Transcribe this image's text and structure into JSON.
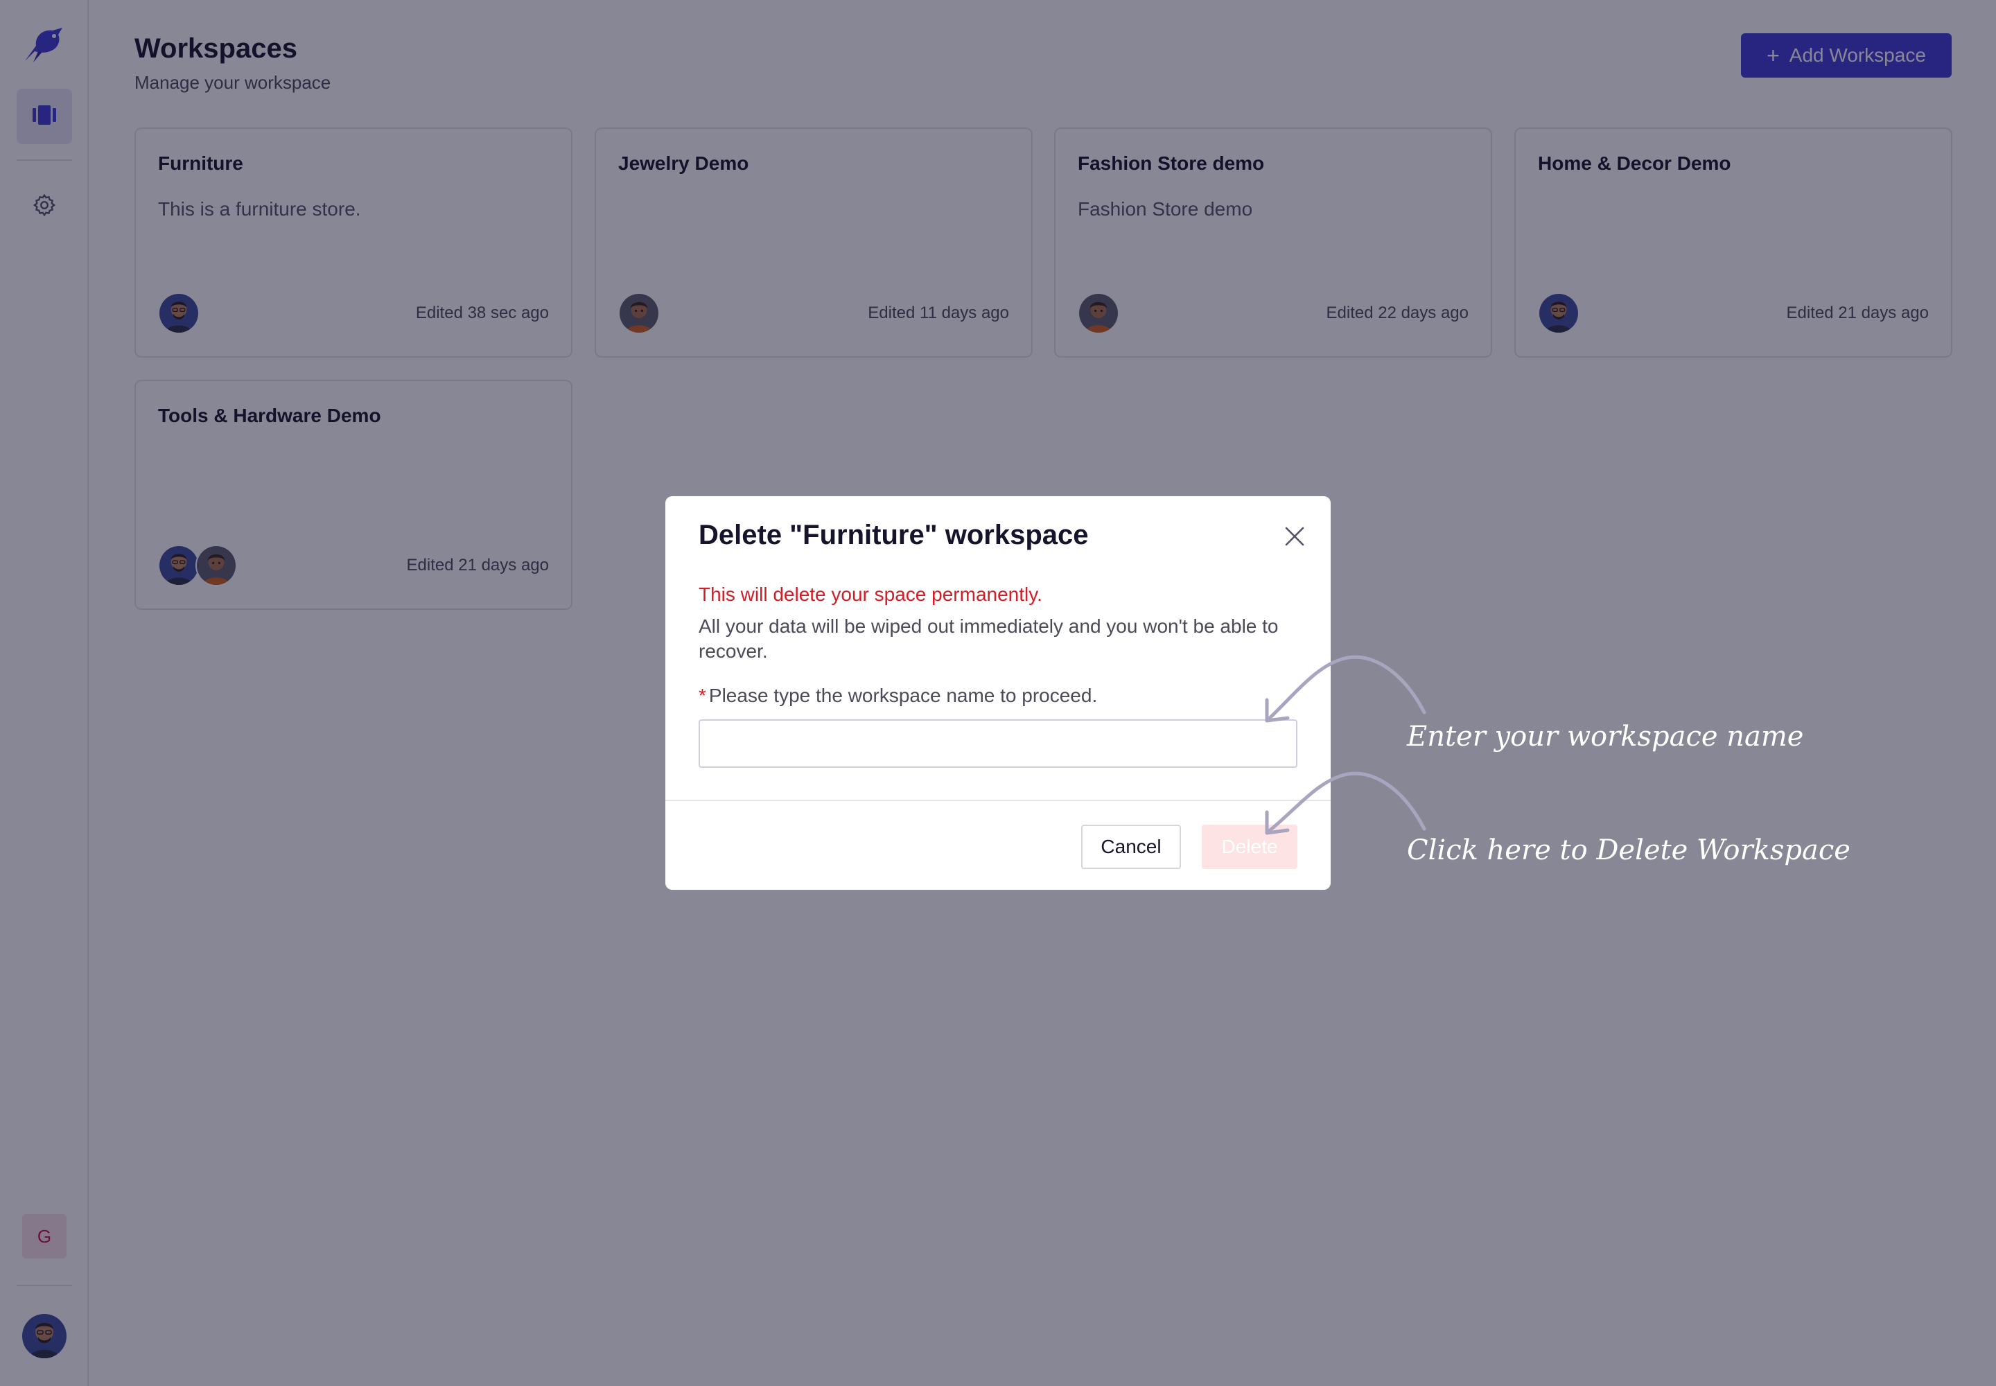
{
  "sidebar": {
    "workspace_initial": "G",
    "icons": {
      "logo": "bird-logo-icon",
      "workspaces": "workspaces-icon",
      "settings": "gear-icon"
    },
    "accent_color": "#3f3ad6"
  },
  "header": {
    "title": "Workspaces",
    "subtitle": "Manage your workspace",
    "add_button_label": "Add Workspace"
  },
  "workspaces": [
    {
      "title": "Furniture",
      "description": "This is a furniture store.",
      "edited": "Edited 38 sec ago",
      "avatars": [
        "user-a"
      ]
    },
    {
      "title": "Jewelry Demo",
      "description": "",
      "edited": "Edited 11 days ago",
      "avatars": [
        "user-b"
      ]
    },
    {
      "title": "Fashion Store demo",
      "description": "Fashion Store demo",
      "edited": "Edited 22 days ago",
      "avatars": [
        "user-b"
      ]
    },
    {
      "title": "Home & Decor Demo",
      "description": "",
      "edited": "Edited 21 days ago",
      "avatars": [
        "user-a"
      ]
    },
    {
      "title": "Tools & Hardware Demo",
      "description": "",
      "edited": "Edited 21 days ago",
      "avatars": [
        "user-a",
        "user-b"
      ]
    }
  ],
  "modal": {
    "title": "Delete \"Furniture\" workspace",
    "warning": "This will delete your space permanently.",
    "body": "All your data will be wiped out immediately and you won't be able to recover.",
    "required_marker": "*",
    "label": "Please type the workspace name to proceed.",
    "input_value": "",
    "cancel_label": "Cancel",
    "delete_label": "Delete",
    "warning_color": "#d31d26"
  },
  "annotations": {
    "input_hint": "Enter your workspace name",
    "delete_hint": "Click here to Delete Workspace"
  }
}
